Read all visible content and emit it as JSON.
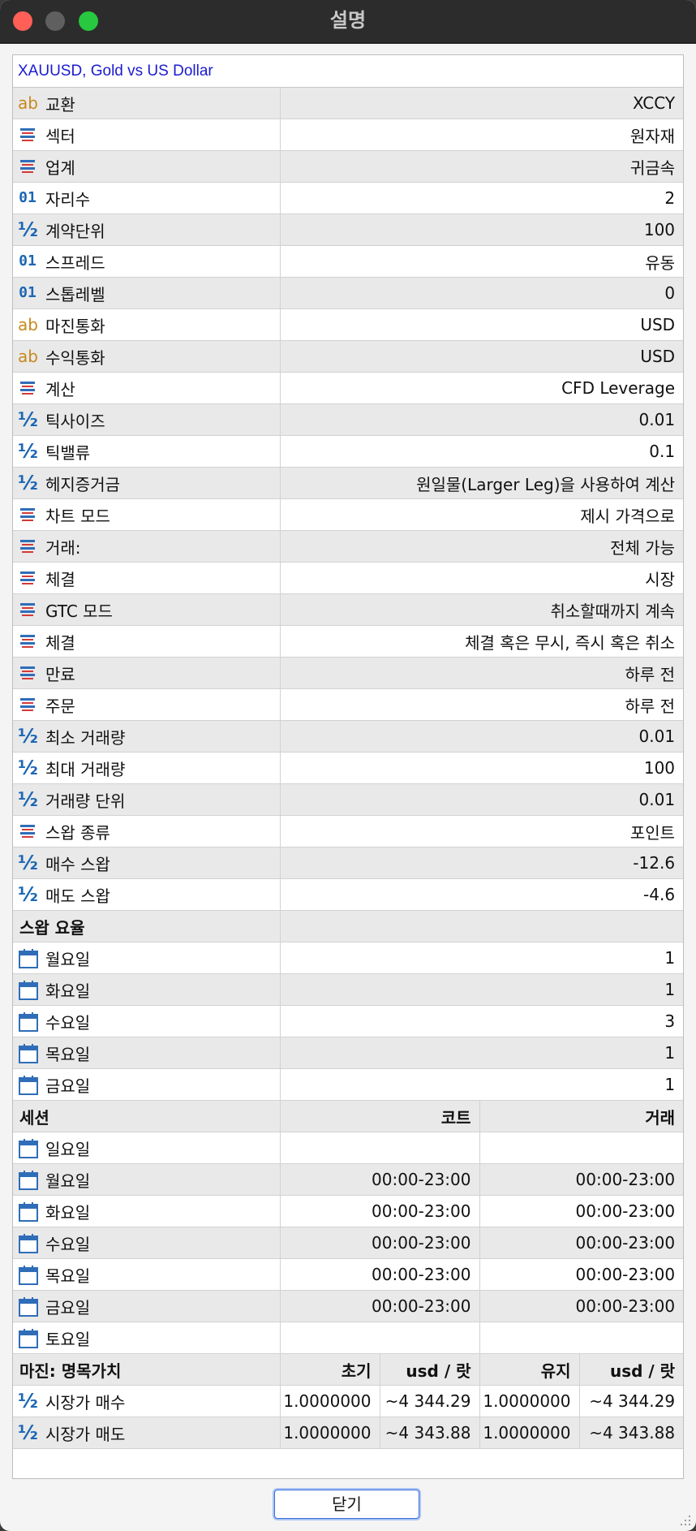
{
  "window": {
    "title": "설명"
  },
  "symbol_header": "XAUUSD, Gold vs US Dollar",
  "properties": [
    {
      "icon": "ab",
      "label": "교환",
      "value": "XCCY"
    },
    {
      "icon": "list",
      "label": "섹터",
      "value": "원자재"
    },
    {
      "icon": "list",
      "label": "업계",
      "value": "귀금속"
    },
    {
      "icon": "01",
      "label": "자리수",
      "value": "2"
    },
    {
      "icon": "half",
      "label": "계약단위",
      "value": "100"
    },
    {
      "icon": "01",
      "label": "스프레드",
      "value": "유동"
    },
    {
      "icon": "01",
      "label": "스톱레벨",
      "value": "0"
    },
    {
      "icon": "ab",
      "label": "마진통화",
      "value": "USD"
    },
    {
      "icon": "ab",
      "label": "수익통화",
      "value": "USD"
    },
    {
      "icon": "list",
      "label": "계산",
      "value": "CFD Leverage"
    },
    {
      "icon": "half",
      "label": "틱사이즈",
      "value": "0.01"
    },
    {
      "icon": "half",
      "label": "틱밸류",
      "value": "0.1"
    },
    {
      "icon": "half",
      "label": "헤지증거금",
      "value": "원일물(Larger Leg)을 사용하여 계산"
    },
    {
      "icon": "list",
      "label": "차트 모드",
      "value": "제시 가격으로"
    },
    {
      "icon": "list",
      "label": "거래:",
      "value": "전체 가능"
    },
    {
      "icon": "list",
      "label": "체결",
      "value": "시장"
    },
    {
      "icon": "list",
      "label": "GTC 모드",
      "value": "취소할때까지 계속"
    },
    {
      "icon": "list",
      "label": "체결",
      "value": "체결 혹은 무시, 즉시 혹은 취소"
    },
    {
      "icon": "list",
      "label": "만료",
      "value": "하루 전"
    },
    {
      "icon": "list",
      "label": "주문",
      "value": "하루 전"
    },
    {
      "icon": "half",
      "label": "최소 거래량",
      "value": "0.01"
    },
    {
      "icon": "half",
      "label": "최대 거래량",
      "value": "100"
    },
    {
      "icon": "half",
      "label": "거래량 단위",
      "value": "0.01"
    },
    {
      "icon": "list",
      "label": "스왑 종류",
      "value": "포인트"
    },
    {
      "icon": "half",
      "label": "매수 스왑",
      "value": "-12.6"
    },
    {
      "icon": "half",
      "label": "매도 스왑",
      "value": "-4.6"
    }
  ],
  "swap_rates": {
    "title": "스왑 요율",
    "days": [
      {
        "label": "월요일",
        "value": "1"
      },
      {
        "label": "화요일",
        "value": "1"
      },
      {
        "label": "수요일",
        "value": "3"
      },
      {
        "label": "목요일",
        "value": "1"
      },
      {
        "label": "금요일",
        "value": "1"
      }
    ]
  },
  "sessions": {
    "title": "세션",
    "col_quote": "코트",
    "col_trade": "거래",
    "days": [
      {
        "label": "일요일",
        "quote": "",
        "trade": ""
      },
      {
        "label": "월요일",
        "quote": "00:00-23:00",
        "trade": "00:00-23:00"
      },
      {
        "label": "화요일",
        "quote": "00:00-23:00",
        "trade": "00:00-23:00"
      },
      {
        "label": "수요일",
        "quote": "00:00-23:00",
        "trade": "00:00-23:00"
      },
      {
        "label": "목요일",
        "quote": "00:00-23:00",
        "trade": "00:00-23:00"
      },
      {
        "label": "금요일",
        "quote": "00:00-23:00",
        "trade": "00:00-23:00"
      },
      {
        "label": "토요일",
        "quote": "",
        "trade": ""
      }
    ]
  },
  "margin": {
    "title": "마진: 명목가치",
    "col_initial": "초기",
    "col_unit1": "usd / 랏",
    "col_maint": "유지",
    "col_unit2": "usd / 랏",
    "rows": [
      {
        "label": "시장가 매수",
        "initial": "1.0000000",
        "usd1": "~4 344.29",
        "maint": "1.0000000",
        "usd2": "~4 344.29"
      },
      {
        "label": "시장가 매도",
        "initial": "1.0000000",
        "usd1": "~4 343.88",
        "maint": "1.0000000",
        "usd2": "~4 343.88"
      }
    ]
  },
  "buttons": {
    "close": "닫기"
  }
}
